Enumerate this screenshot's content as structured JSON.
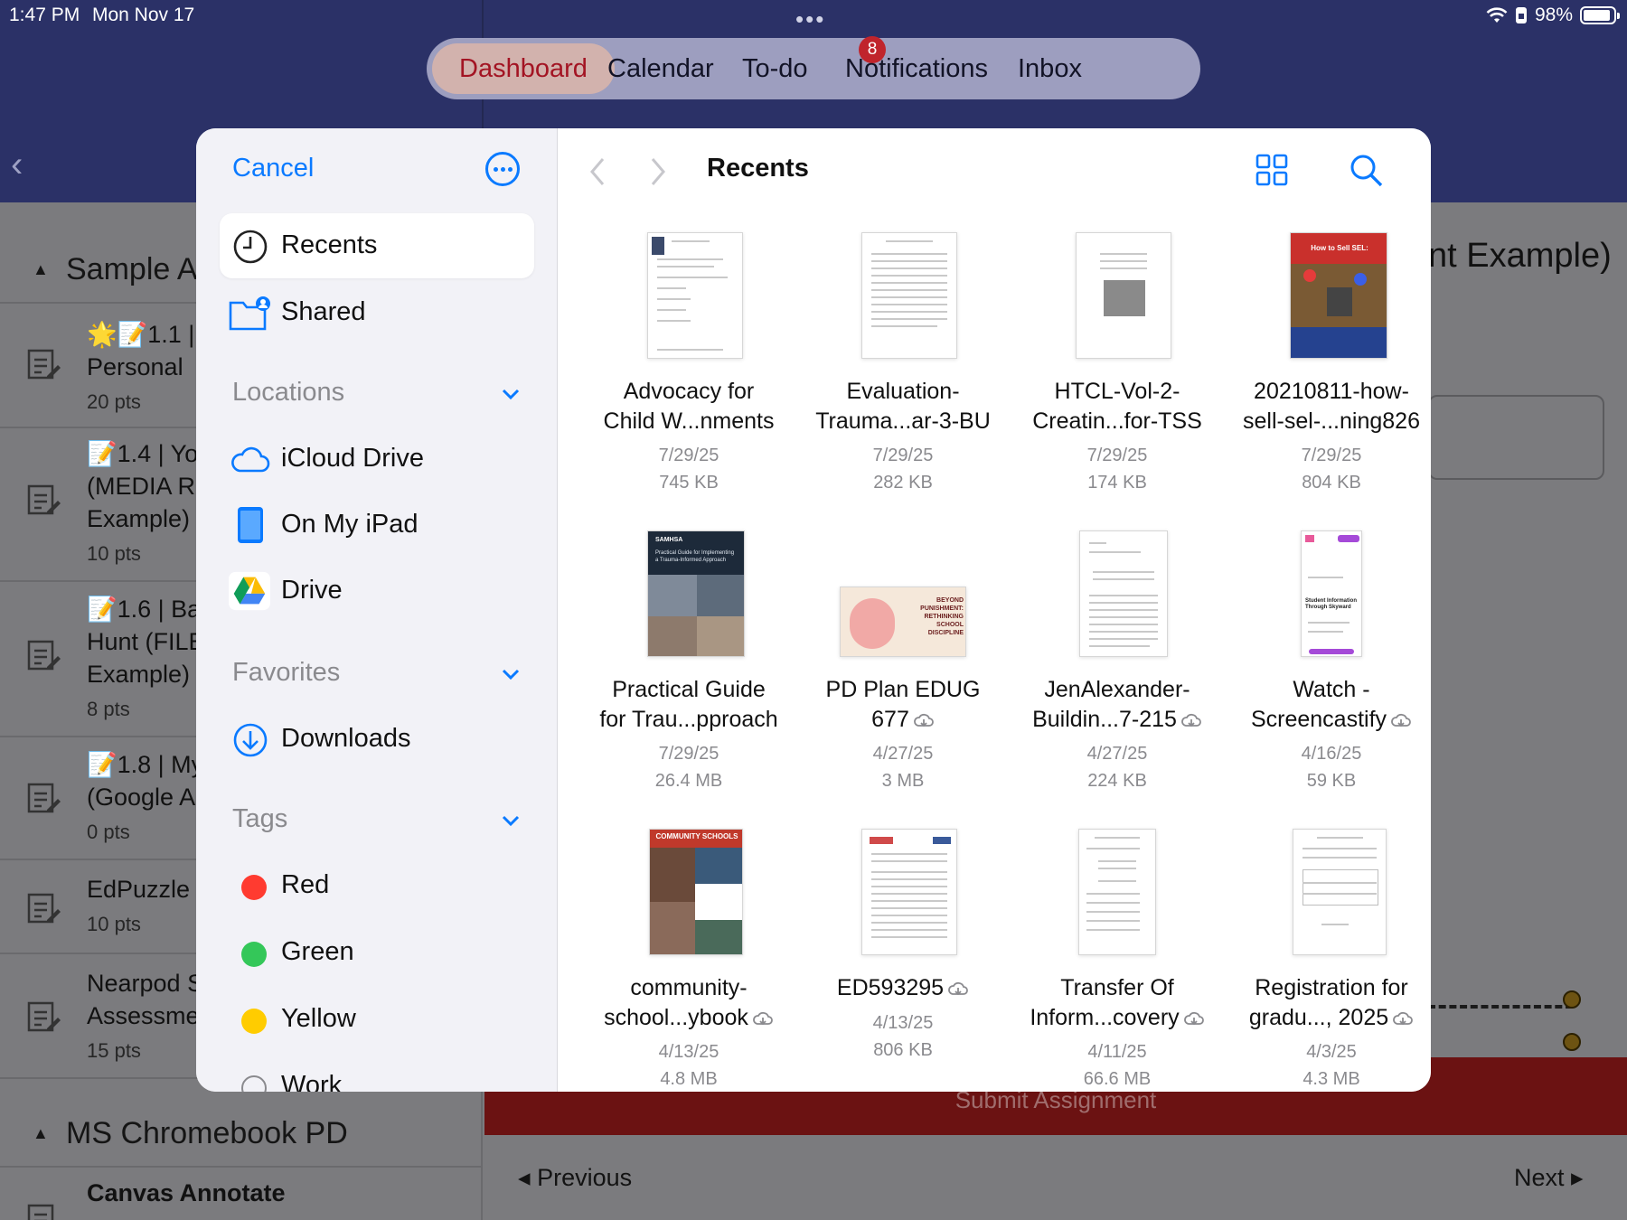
{
  "status": {
    "time": "1:47 PM",
    "date": "Mon Nov 17",
    "battery": "98%",
    "battery_level": 0.98
  },
  "app_tabs": [
    {
      "label": "Dashboard",
      "active": true
    },
    {
      "label": "Calendar",
      "active": false
    },
    {
      "label": "To-do",
      "badge": "8",
      "active": false
    },
    {
      "label": "Notifications",
      "active": false
    },
    {
      "label": "Inbox",
      "active": false
    }
  ],
  "background": {
    "section1": "Sample As",
    "items": [
      {
        "title1": "🌟📝1.1 |",
        "title2": "Personal",
        "pts": "20 pts"
      },
      {
        "title1": "📝1.4 | Yo",
        "title2": "(MEDIA R",
        "title3": "Example)",
        "pts": "10 pts"
      },
      {
        "title1": "📝1.6 | Ba",
        "title2": "Hunt (FILE",
        "title3": "Example)",
        "pts": "8 pts"
      },
      {
        "title1": "📝1.8 | My",
        "title2": "(Google As",
        "pts": "0 pts"
      },
      {
        "title1": "EdPuzzle E",
        "pts": "10 pts"
      },
      {
        "title1": "Nearpod S",
        "title2": "Assessmen",
        "pts": "15 pts"
      }
    ],
    "section2": "MS Chromebook PD",
    "last_item": "Canvas Annotate",
    "heading_right": "nt Example)",
    "submit": "Submit Assignment",
    "previous": "Previous",
    "next": "Next"
  },
  "picker": {
    "cancel": "Cancel",
    "sidebar": {
      "recents": "Recents",
      "shared": "Shared",
      "locations_header": "Locations",
      "locations": [
        "iCloud Drive",
        "On My iPad",
        "Drive"
      ],
      "favorites_header": "Favorites",
      "favorites": [
        "Downloads"
      ],
      "tags_header": "Tags",
      "tags": [
        {
          "label": "Red",
          "color": "#ff3b30"
        },
        {
          "label": "Green",
          "color": "#34c759"
        },
        {
          "label": "Yellow",
          "color": "#ffcc00"
        },
        {
          "label": "Work",
          "color": "none"
        }
      ]
    },
    "title": "Recents",
    "files": [
      {
        "name1": "Advocacy for",
        "name2": "Child W...nments",
        "date": "7/29/25",
        "size": "745 KB",
        "cloud": false
      },
      {
        "name1": "Evaluation-",
        "name2": "Trauma...ar-3-BU",
        "date": "7/29/25",
        "size": "282 KB",
        "cloud": false
      },
      {
        "name1": "HTCL-Vol-2-",
        "name2": "Creatin...for-TSS",
        "date": "7/29/25",
        "size": "174 KB",
        "cloud": false
      },
      {
        "name1": "20210811-how-",
        "name2": "sell-sel-...ning826",
        "date": "7/29/25",
        "size": "804 KB",
        "cloud": false
      },
      {
        "name1": "Practical Guide",
        "name2": "for Trau...pproach",
        "date": "7/29/25",
        "size": "26.4 MB",
        "cloud": false
      },
      {
        "name1": "PD Plan EDUG",
        "name2": "677",
        "date": "4/27/25",
        "size": "3 MB",
        "cloud": true
      },
      {
        "name1": "JenAlexander-",
        "name2": "Buildin...7-215",
        "date": "4/27/25",
        "size": "224 KB",
        "cloud": true
      },
      {
        "name1": "Watch -",
        "name2": "Screencastify",
        "date": "4/16/25",
        "size": "59 KB",
        "cloud": true
      },
      {
        "name1": "community-",
        "name2": "school...ybook",
        "date": "4/13/25",
        "size": "4.8 MB",
        "cloud": true
      },
      {
        "name1": "ED593295",
        "name2": "",
        "date": "4/13/25",
        "size": "806 KB",
        "cloud": true
      },
      {
        "name1": "Transfer Of",
        "name2": "Inform...covery",
        "date": "4/11/25",
        "size": "66.6 MB",
        "cloud": true
      },
      {
        "name1": "Registration for",
        "name2": "gradu..., 2025",
        "date": "4/3/25",
        "size": "4.3 MB",
        "cloud": true
      }
    ],
    "thumb_text": {
      "sel_cover": "How to Sell SEL:",
      "samhsa": "SAMHSA",
      "samhsa_title": "Practical Guide for Implementing a Trauma-Informed Approach",
      "beyond": "BEYOND PUNISHMENT: RETHINKING SCHOOL DISCIPLINE",
      "community": "COMMUNITY SCHOOLS",
      "student_info": "Student Information Through Skyward"
    }
  }
}
